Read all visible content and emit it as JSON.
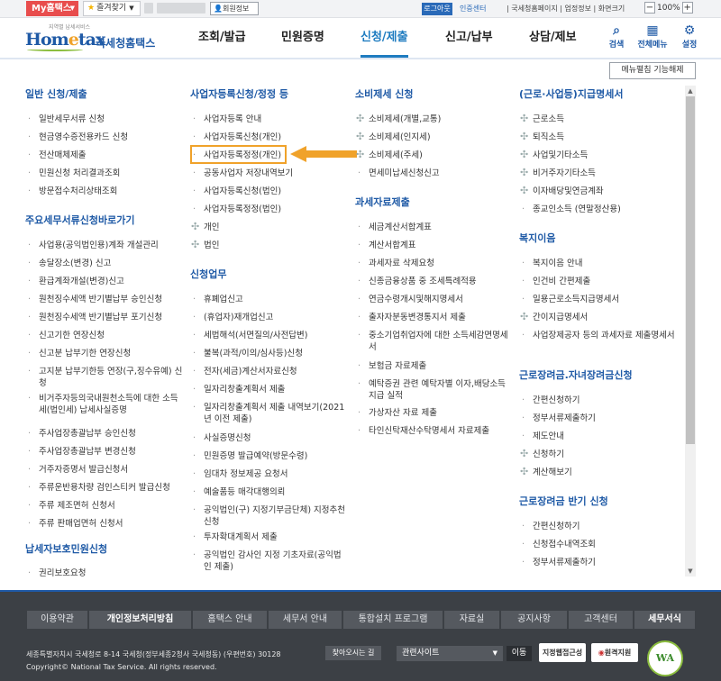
{
  "topbar": {
    "my_label": "My홈택스",
    "favorites_label": "즐겨찾기",
    "member_info": "회원정보",
    "logout": "로그아웃",
    "auth_center": "인증센터",
    "links": "| 국세청홈페이지 | 업정정보 | 화면크기",
    "zoom": "100%"
  },
  "header": {
    "logo_slogan": "지역별 납세서비스",
    "logo_text_a": "Hom",
    "logo_text_e": "e",
    "logo_text_b": "tax",
    "logo_korean": "국세청홈택스",
    "nav": [
      "조회/발급",
      "민원증명",
      "신청/제출",
      "신고/납부",
      "상담/제보"
    ],
    "icons": [
      {
        "label": "검색",
        "icon": "search-icon"
      },
      {
        "label": "전체메뉴",
        "icon": "grid-menu-icon"
      },
      {
        "label": "설정",
        "icon": "gear-icon"
      }
    ]
  },
  "menu_edit": "메뉴펼침 기능해제",
  "columns": {
    "c1": {
      "title1": "일반 신청/제출",
      "items1": [
        "일반세무서류 신청",
        "현금영수증전용카드 신청",
        "전산매체제출",
        "민원신청 처리결과조회",
        "방문접수처리상태조회"
      ],
      "title2": "주요세무서류신청바로가기",
      "items2": [
        "사업용(공익법인용)계좌 개설관리",
        "송달장소(변경) 신고",
        "환급계좌개설(변경)신고",
        "원천징수세액 반기별납부 승인신청",
        "원천징수세액 반기별납부 포기신청",
        "신고기한 연장신청",
        "신고분 납부기한 연장신청",
        "고지분 납부기한등 연장(구,징수유예) 신청",
        "비거주자등의국내원천소득에 대한 소득세(법인세) 납세사실증명",
        "주사업장총괄납부 승인신청",
        "주사업장총괄납부 변경신청",
        "거주자증명서 발급신청서",
        "주류운반용차량 검인스티커 발급신청",
        "주류 제조면허 신청서",
        "주류 판매업면허 신청서"
      ],
      "title3": "납세자보호민원신청",
      "items3": [
        "권리보호요청"
      ]
    },
    "c2": {
      "title1": "사업자등록신청/정정 등",
      "items1": [
        "사업자등록 안내",
        "사업자등록신청(개인)",
        "사업자등록정정(개인)",
        "공동사업자 저장내역보기",
        "사업자등록신청(법인)",
        "사업자등록정정(법인)",
        "개인",
        "법인"
      ],
      "title2": "신청업무",
      "items2": [
        "휴폐업신고",
        "(휴업자)재개업신고",
        "세법해석(서면질의/사전답변)",
        "불복(과적/이의/심사등)신청",
        "전자(세금)계산서자료신청",
        "일자리창출계획서 제출",
        "일자리창출계획서 제출 내역보기(2021년 이전 제출)",
        "사실증명신청",
        "민원증명 발급예약(방문수령)",
        "임대차 정보제공 요청서",
        "예술품등 매각대행의뢰",
        "공익법인(구) 지정기부금단체) 지정추천 신청",
        "투자확대계획서 제출",
        "공익법인 감사인 지정 기초자료(공익법인 제출)"
      ]
    },
    "c3": {
      "title1": "소비제세 신청",
      "items1": [
        "소비제세(개별,교통)",
        "소비제세(인지세)",
        "소비제세(주세)",
        "면세미납세신청신고"
      ],
      "title2": "과세자료제출",
      "items2": [
        "세금계산서합계표",
        "계산서합계표",
        "과세자료 삭제요청",
        "신종금융상품 중 조세특례적용",
        "연금수령개시및해지명세서",
        "출자자분동변경통지서 제출",
        "중소기업취업자에 대한 소득세감면명세서",
        "보험금 자료제출",
        "예탁증권 관련 예탁자별 이자,배당소득지급 실적",
        "가상자산 자료 제출",
        "타인신탁재산수탁명세서 자료제출"
      ]
    },
    "c4": {
      "title1": "(근로·사업등)지급명세서",
      "items1": [
        "근로소득",
        "퇴직소득",
        "사업및기타소득",
        "비거주자기타소득",
        "이자배당및연금계좌",
        "종교인소득 (연말정산용)"
      ],
      "title2": "복지이음",
      "items2": [
        "복지이음 안내",
        "인건비 간편제출",
        "일용근로소득지급명세서",
        "간이지급명세서",
        "사업장제공자 등의 과세자료 제출명세서"
      ],
      "title3": "근로장려금.자녀장려금신청",
      "items3": [
        "간편신청하기",
        "정부서류제출하기",
        "제도안내",
        "신청하기",
        "계산해보기"
      ],
      "title4": "근로장려금 반기 신청",
      "items4": [
        "간편신청하기",
        "신청접수내역조회",
        "정부서류제출하기"
      ]
    }
  },
  "footer": {
    "nav": [
      "이용약관",
      "개인정보처리방침",
      "홈택스 안내",
      "세무서 안내",
      "통합설치 프로그램",
      "자료실",
      "공지사항",
      "고객센터",
      "세무서식"
    ],
    "address": "세종특별자치시 국세청로 8-14 국세청(정부세종2청사 국세청동) (우편번호) 30128",
    "find_way": "찾아오시는 길",
    "copyright": "Copyright© National Tax Service. All rights reserved.",
    "related_sites": "관련사이트",
    "go": "이동",
    "badge1": "지정웹접근성",
    "badge2": "원격지원",
    "wa": "WA"
  },
  "accent_color": "#1f5aa6",
  "highlight_color": "#f0a22a"
}
